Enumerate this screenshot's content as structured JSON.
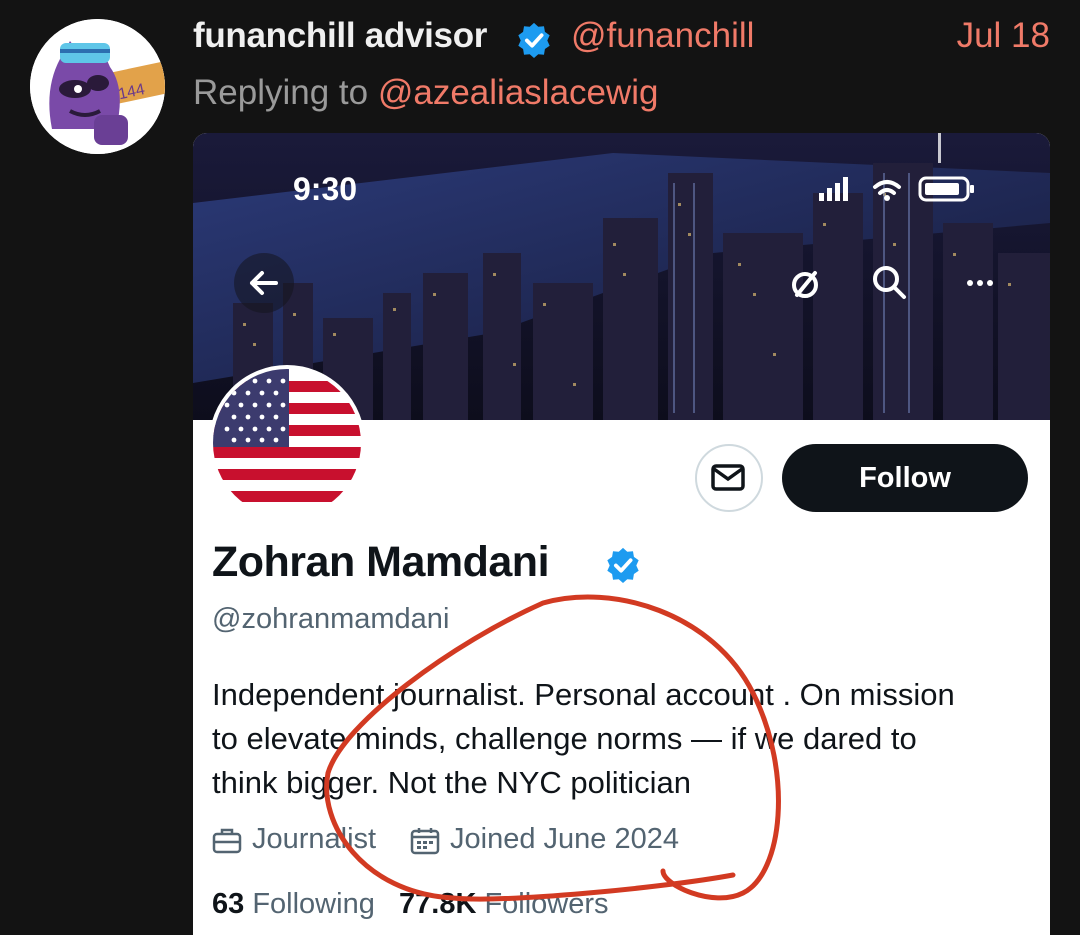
{
  "post": {
    "author_name": "funanchill advisor",
    "author_handle": "@funanchill",
    "date": "Jul 18",
    "reply_prefix": "Replying to",
    "reply_to": "@azealiaslacewig",
    "avatar_sign_text": "4144"
  },
  "screenshot": {
    "status_time": "9:30",
    "profile": {
      "display_name": "Zohran Mamdani",
      "handle": "@zohranmamdani",
      "bio_lines": [
        "Independent journalist. Personal account . On mission",
        "to elevate minds, challenge norms — if we dared to",
        "think bigger. Not the NYC politician"
      ],
      "profession": "Journalist",
      "joined": "Joined June 2024",
      "following_count": "63",
      "following_label": "Following",
      "followers_count": "77.8K",
      "followers_label": "Followers",
      "follow_label": "Follow"
    }
  },
  "colors": {
    "background": "#131313",
    "accent": "#f07a68",
    "verified": "#1d9bf0",
    "annotation": "#d23a22"
  },
  "icons": [
    "verified-badge-icon",
    "back-arrow-icon",
    "share-icon",
    "search-icon",
    "more-icon",
    "mail-icon",
    "briefcase-icon",
    "calendar-icon",
    "signal-icon",
    "wifi-icon",
    "battery-icon"
  ]
}
